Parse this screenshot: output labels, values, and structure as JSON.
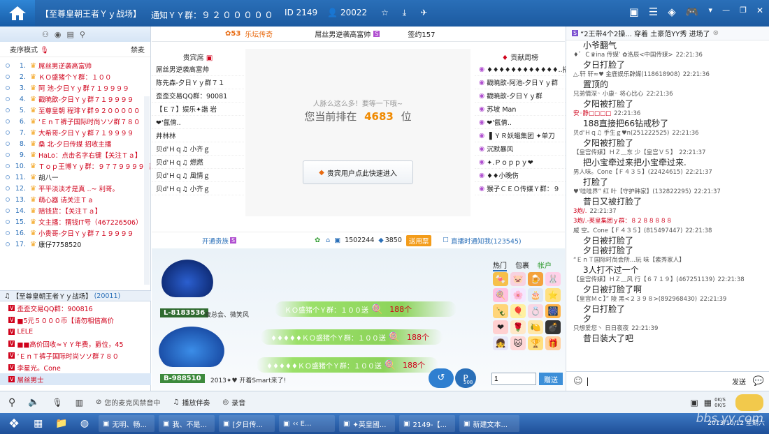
{
  "titlebar": {
    "channel": "【至尊皇朝王者Ｙｙ战场】",
    "notice_label": "通知ＹＹ群：",
    "notice_num": "９２０００００",
    "id": "ID 2149",
    "users": "20022"
  },
  "left": {
    "mode_label": "麦序模式",
    "ban_label": "禁麦",
    "mic_queue": [
      {
        "n": "1.",
        "t": "屌丝男逆袭高富帅"
      },
      {
        "n": "2.",
        "t": "ＫＯ盛猪个Ｙ群：１００"
      },
      {
        "n": "3.",
        "t": "阿 池-夕日Ｙｙ群７１９９９９"
      },
      {
        "n": "4.",
        "t": "戳暁歆-夕日Ｙｙ群７１９９９９"
      },
      {
        "n": "5.",
        "t": "至尊皇朝 程琲Ｙ群９２０００００"
      },
      {
        "n": "6.",
        "t": "‘ＥｎＴ裤子国际时尚ソソ群７８０"
      },
      {
        "n": "7.",
        "t": "大希哥-夕日Ｙｙ群７１９９９９"
      },
      {
        "n": "8.",
        "t": "桑 北-夕日传媒 招收主播"
      },
      {
        "n": "9.",
        "t": "HaLo：点击名字右键【关注Ｔａ】"
      },
      {
        "n": "10.",
        "t": "Ｔｏｐ王博Ｙｙ群：９７７９９９９战"
      },
      {
        "n": "11.",
        "t": "胡八一"
      },
      {
        "n": "12.",
        "t": "平平淡淡才是真 ..~ 利哥。"
      },
      {
        "n": "13.",
        "t": "萌心器 请关注Ｔａ"
      },
      {
        "n": "14.",
        "t": "赔钱货：【关注Ｔａ】"
      },
      {
        "n": "15.",
        "t": "文主播：猬钱IT号（467226506）"
      },
      {
        "n": "16.",
        "t": "小贵哥-夕日Ｙｙ群７１９９９９"
      },
      {
        "n": "17.",
        "t": "康仔7758520"
      }
    ],
    "channel_bar": "【至尊皇朝王者Ｙｙ战场】",
    "channel_id": "(20011)",
    "vip_list": [
      "歪歪交易QQ群：900816",
      "■5元５０００币【请勿相信高价",
      "LELE",
      "■■高价回收≈ＹＹ年费，爵位，45",
      "‘ＥｎＴ裤子国际时尚ソソ群７８０",
      "李星光。Cone",
      "屌丝男士"
    ]
  },
  "center": {
    "top": {
      "level": "53",
      "activity": "乐坛传奇",
      "host": "屌丝男逆袭高富帅",
      "sign": "签约157"
    },
    "guest_title": "贵宾席",
    "guests": [
      "屌丝男逆袭高富帅",
      "陈先森-夕日Ｙｙ群７１",
      "歪歪交易QQ群：90081",
      "【Ｅ７】娱乐✦諧 岩",
      "❤'氤俼..",
      "井林林",
      "⻉d'Ｈｑ♫ 小齐ｇ",
      "⻉d'Ｈｑ♫ 燃燃",
      "⻉d'Ｈｑ♫ 風情ｇ",
      "⻉d'Ｈｑ♫ 小齐ｇ"
    ],
    "queue_hint": "人脉么这么多！要等一下哦~",
    "queue_prefix": "您当前排在",
    "queue_pos": "4683",
    "queue_suffix": "位",
    "vip_enter": "贵宾用户点此快速进入",
    "contrib_title": "贡献周榜",
    "contrib": [
      "♦♦♦♦♦♦♦♦♦♦♦♦..播专",
      "戳暁歆-阿池-夕日Ｙｙ群",
      "戳暁歆-夕日Ｙｙ群",
      "苏坡 Man",
      "❤'氤俼..",
      "▐ ＹＲ妖蛾集团 ✦单刀",
      "沉默暴风",
      "✦.Ｐｏｐｐｙ❤",
      "♦♦小晚伤",
      "猴子ＣＥＯ传媒Ｙ群：９"
    ],
    "open_noble": "开通贵族",
    "flower": "1502244",
    "diamond": "3850",
    "send_btn": "送用票",
    "notify": "直播时通知我(123545)",
    "gifts": [
      {
        "txt": "ＫＯ盛猪个Ｙ群：１００送",
        "cnt": "188个"
      },
      {
        "txt": "♦♦♦♦♦ＫＯ盛猪个Ｙ群：１００送",
        "cnt": "188个"
      },
      {
        "txt": "♦♦♦♦♦ＫＯ盛猪个Ｙ群：１００送",
        "cnt": "188个"
      }
    ],
    "plate1": "L-8183536",
    "plate1_owner": "夜总会、微笑风",
    "plate2": "B-988510",
    "plate2_msg": "2013✦♥ 开着Smart来了!",
    "gift_tabs": [
      "热门",
      "包裹",
      "帐户"
    ],
    "qty": "1",
    "give": "赠送",
    "p_badge": "508"
  },
  "right": {
    "notice": "“2王带4个2操... 穿着 土豪范YY秀 进场了",
    "messages": [
      {
        "h": "",
        "b": "小爷翻气"
      },
      {
        "h": "♦゛Ｃ♛ina 传媒’ ✿洛辰<中国传媒>",
        "tm": "22:21:36",
        "b": ""
      },
      {
        "h": "",
        "b": "夕日打脸了"
      },
      {
        "h": "△.轩 轩≈♥ 金鹿娱乐辟媒(118618908)",
        "tm": "22:21:36",
        "b": "置顶的"
      },
      {
        "h": "兄弟情深◦ 小康◦ 将心比心",
        "tm": "22:21:36",
        "b": "夕阳被打脸了"
      },
      {
        "h": "安◦静□□□□",
        "tm": "22:21:36",
        "b": "188直接把66钻戒秒了",
        "red": true
      },
      {
        "h": "⻉d'Ｈｑ♫ 手生ｇ♥n(251222525)",
        "tm": "22:21:36",
        "b": "夕阳被打脸了"
      },
      {
        "h": "【皇宫传媒】ＨＺ＿东 少【皇宫Ｖ５】",
        "tm": "22:21:37",
        "b": "把小宝牵过来把小宝牵过来."
      },
      {
        "h": "男人味。Cone【Ｆ４３５】(22424615)",
        "tm": "22:21:37",
        "b": "打脸了"
      },
      {
        "h": "♥'哇哇界” 红 叶【守护韩家】(132822295)",
        "tm": "22:21:37",
        "b": "昔日又被打脸了"
      },
      {
        "h": "3炮/.",
        "tm": "22:21:37",
        "b": "",
        "red": true
      },
      {
        "h": "3炮/.-英皇集团ｙ群：８２８８８８８",
        "tm": "",
        "b": "",
        "red": true
      },
      {
        "h": "威 空。Cone【Ｆ４３５】(815497447)",
        "tm": "22:21:38",
        "b": "夕日被打脸了"
      },
      {
        "h": "",
        "b": "夕日被打脸了"
      },
      {
        "h": "“ＥｎＴ国际时尚会所...玩 味【素秀家人】",
        "tm": "",
        "b": "3人打不过一个"
      },
      {
        "h": "【皇宫传媒】ＨＺ＿风 行【６７１９】(467251139)",
        "tm": "22:21:38",
        "b": "夕日被打脸了啊"
      },
      {
        "h": "【皇宫Ｍｃ】” 陵 黑<２３９８>(892968430)",
        "tm": "22:21:39",
        "b": "夕日打脸了"
      },
      {
        "h": "",
        "b": "夕"
      },
      {
        "h": "只想爱您丶 日日夜夜",
        "tm": "22:21:39",
        "b": "昔日装大了吧"
      }
    ],
    "send": "发送"
  },
  "bottom": {
    "mic_status": "您的麦克风禁音中",
    "accompany": "播放伴奏",
    "record": "录音",
    "speed1": "0K/S",
    "speed2": "0K/S"
  },
  "taskbar": {
    "items": [
      "无明、畅...",
      "我、不是...",
      "[夕日传...",
      "‹‹ E...",
      "✦英皇國...",
      "2149-【...",
      "新建文本..."
    ],
    "date": "2013/10/12 星期六"
  },
  "watermark": "bbs.yy.com"
}
